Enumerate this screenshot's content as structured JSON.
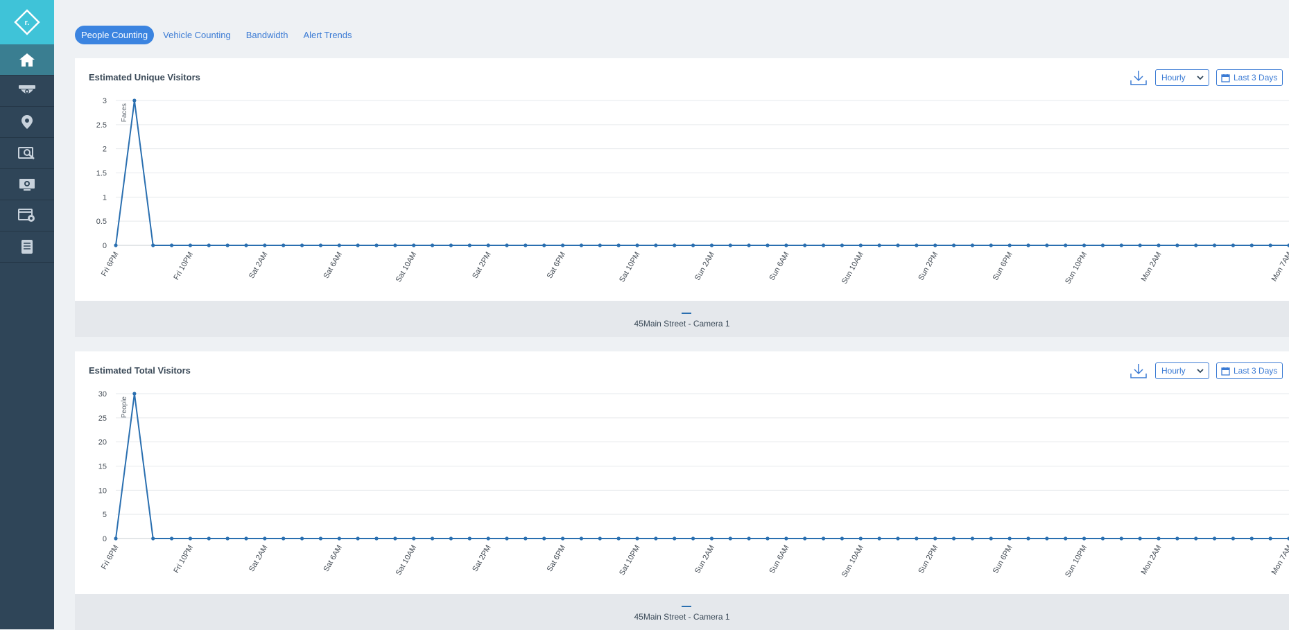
{
  "sidebar": {
    "logo_letter": "r.",
    "items": [
      {
        "icon": "home-icon",
        "active": true
      },
      {
        "icon": "camera-icon",
        "active": false
      },
      {
        "icon": "map-pin-icon",
        "active": false
      },
      {
        "icon": "search-video-icon",
        "active": false
      },
      {
        "icon": "monitor-camera-icon",
        "active": false
      },
      {
        "icon": "video-settings-icon",
        "active": false
      },
      {
        "icon": "document-icon",
        "active": false
      }
    ]
  },
  "tabs": [
    {
      "label": "People Counting",
      "active": true
    },
    {
      "label": "Vehicle Counting",
      "active": false
    },
    {
      "label": "Bandwidth",
      "active": false
    },
    {
      "label": "Alert Trends",
      "active": false
    }
  ],
  "cards": [
    {
      "title": "Estimated Unique Visitors",
      "interval": "Hourly",
      "range": "Last 3 Days",
      "legend": "45Main Street - Camera 1"
    },
    {
      "title": "Estimated Total Visitors",
      "interval": "Hourly",
      "range": "Last 3 Days",
      "legend": "45Main Street - Camera 1"
    }
  ],
  "colors": {
    "accent": "#3b84e0",
    "series": "#2a6fb0",
    "sidebar": "#2f4558",
    "logo_bg": "#3fc3d8"
  },
  "chart_data": [
    {
      "type": "line",
      "title": "Estimated Unique Visitors",
      "ylabel": "Faces",
      "ylim": [
        0,
        3
      ],
      "yticks": [
        "3",
        "2.5",
        "2",
        "1.5",
        "1",
        "0.5",
        "0"
      ],
      "xtick_labels": [
        "Fri 6PM",
        "Fri 10PM",
        "Sat 2AM",
        "Sat 6AM",
        "Sat 10AM",
        "Sat 2PM",
        "Sat 6PM",
        "Sat 10PM",
        "Sun 2AM",
        "Sun 6AM",
        "Sun 10AM",
        "Sun 2PM",
        "Sun 6PM",
        "Sun 10PM",
        "Mon 2AM",
        "Mon 7AM"
      ],
      "series": [
        {
          "name": "45Main Street - Camera 1",
          "values": [
            0,
            3,
            0,
            0,
            0,
            0,
            0,
            0,
            0,
            0,
            0,
            0,
            0,
            0,
            0,
            0,
            0,
            0,
            0,
            0,
            0,
            0,
            0,
            0,
            0,
            0,
            0,
            0,
            0,
            0,
            0,
            0,
            0,
            0,
            0,
            0,
            0,
            0,
            0,
            0,
            0,
            0,
            0,
            0,
            0,
            0,
            0,
            0,
            0,
            0,
            0,
            0,
            0,
            0,
            0,
            0,
            0,
            0,
            0,
            0,
            0,
            0,
            0,
            0
          ]
        }
      ]
    },
    {
      "type": "line",
      "title": "Estimated Total Visitors",
      "ylabel": "People",
      "ylim": [
        0,
        30
      ],
      "yticks": [
        "30",
        "25",
        "20",
        "15",
        "10",
        "5",
        "0"
      ],
      "xtick_labels": [
        "Fri 6PM",
        "Fri 10PM",
        "Sat 2AM",
        "Sat 6AM",
        "Sat 10AM",
        "Sat 2PM",
        "Sat 6PM",
        "Sat 10PM",
        "Sun 2AM",
        "Sun 6AM",
        "Sun 10AM",
        "Sun 2PM",
        "Sun 6PM",
        "Sun 10PM",
        "Mon 2AM",
        "Mon 7AM"
      ],
      "series": [
        {
          "name": "45Main Street - Camera 1",
          "values": [
            0,
            30,
            0,
            0,
            0,
            0,
            0,
            0,
            0,
            0,
            0,
            0,
            0,
            0,
            0,
            0,
            0,
            0,
            0,
            0,
            0,
            0,
            0,
            0,
            0,
            0,
            0,
            0,
            0,
            0,
            0,
            0,
            0,
            0,
            0,
            0,
            0,
            0,
            0,
            0,
            0,
            0,
            0,
            0,
            0,
            0,
            0,
            0,
            0,
            0,
            0,
            0,
            0,
            0,
            0,
            0,
            0,
            0,
            0,
            0,
            0,
            0,
            0,
            0
          ]
        }
      ]
    }
  ]
}
